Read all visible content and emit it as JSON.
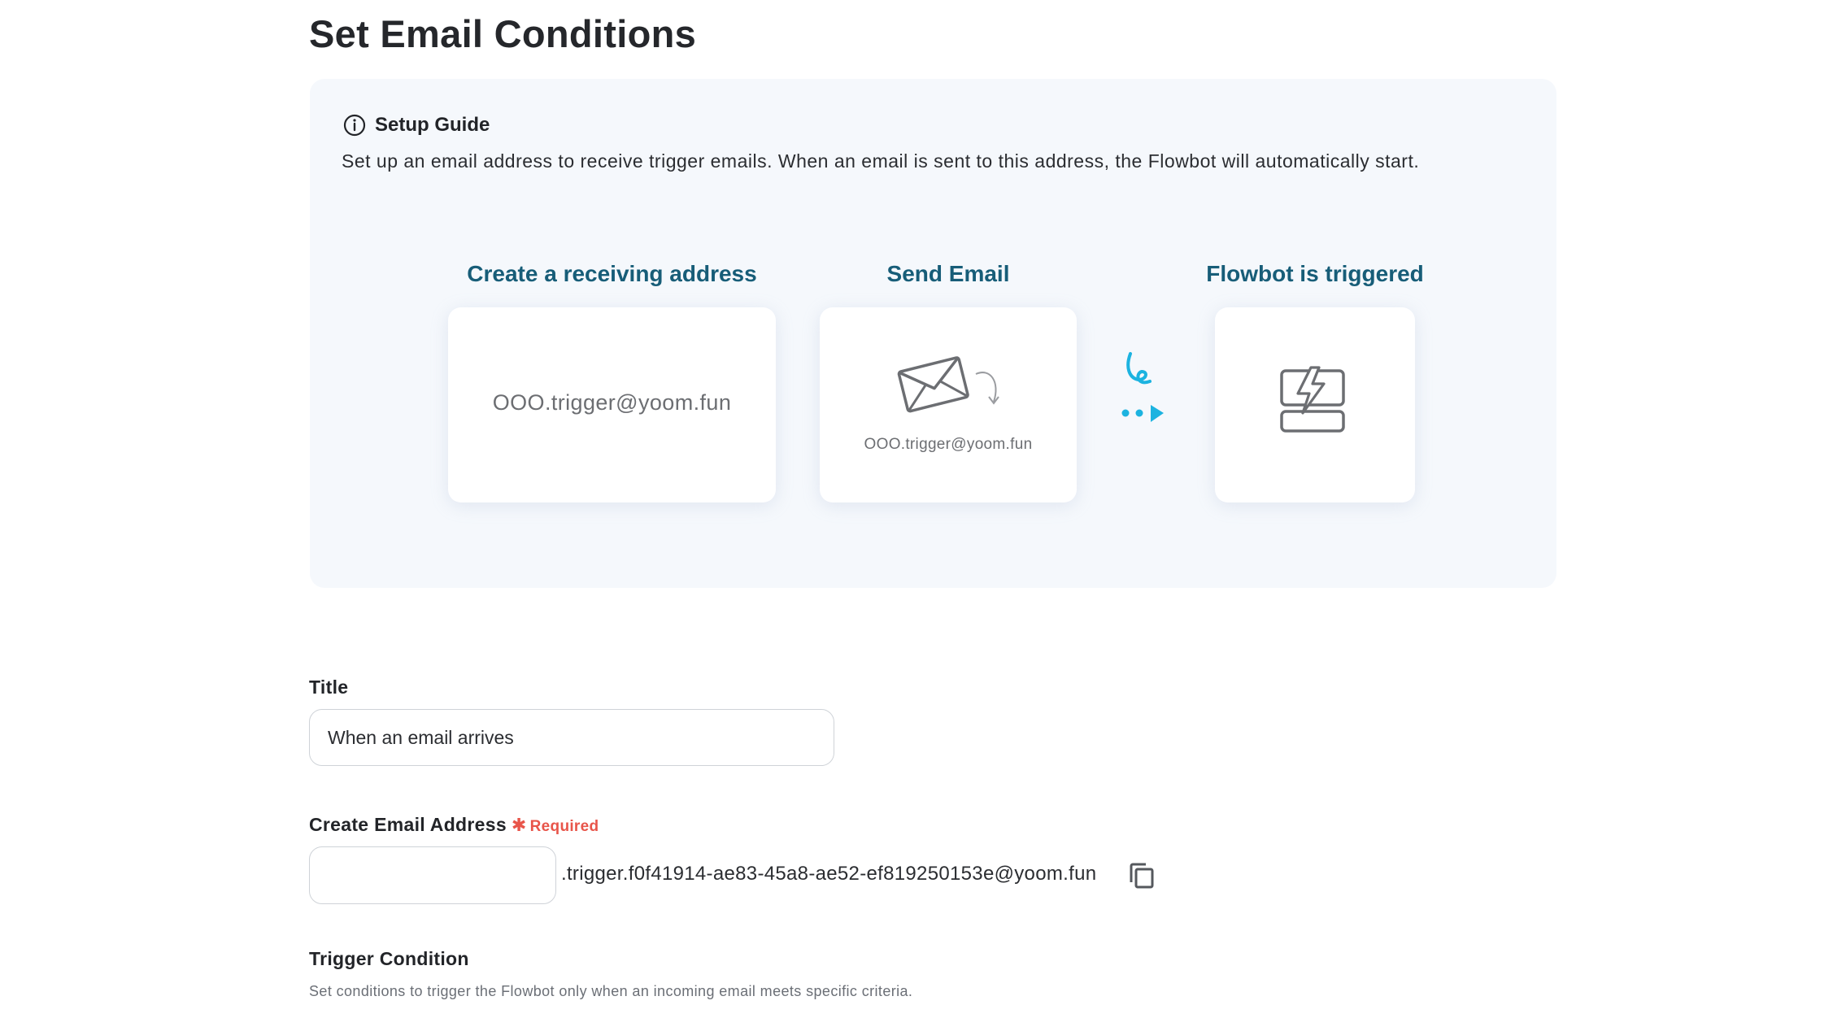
{
  "page": {
    "title": "Set Email Conditions"
  },
  "guide": {
    "heading": "Setup Guide",
    "description": "Set up an email address to receive trigger emails. When an email is sent to this address, the Flowbot will automatically start.",
    "steps": [
      {
        "title": "Create a receiving address",
        "caption": "OOO.trigger@yoom.fun"
      },
      {
        "title": "Send Email",
        "caption": "OOO.trigger@yoom.fun"
      },
      {
        "title": "Flowbot is triggered"
      }
    ],
    "colors": {
      "accent": "#175d78",
      "arrow": "#1cb3e0",
      "panel": "#f5f8fc"
    }
  },
  "form": {
    "title_field": {
      "label": "Title",
      "value": "When an email arrives"
    },
    "email_field": {
      "label": "Create Email Address",
      "required_text": "Required",
      "value": "",
      "suffix": ".trigger.f0f41914-ae83-45a8-ae52-ef819250153e@yoom.fun"
    },
    "trigger": {
      "label": "Trigger Condition",
      "helper": "Set conditions to trigger the Flowbot only when an incoming email meets specific criteria."
    }
  },
  "icons": [
    "info-icon",
    "envelope-icon",
    "flowbot-server-icon",
    "copy-icon",
    "arrow-icon"
  ]
}
